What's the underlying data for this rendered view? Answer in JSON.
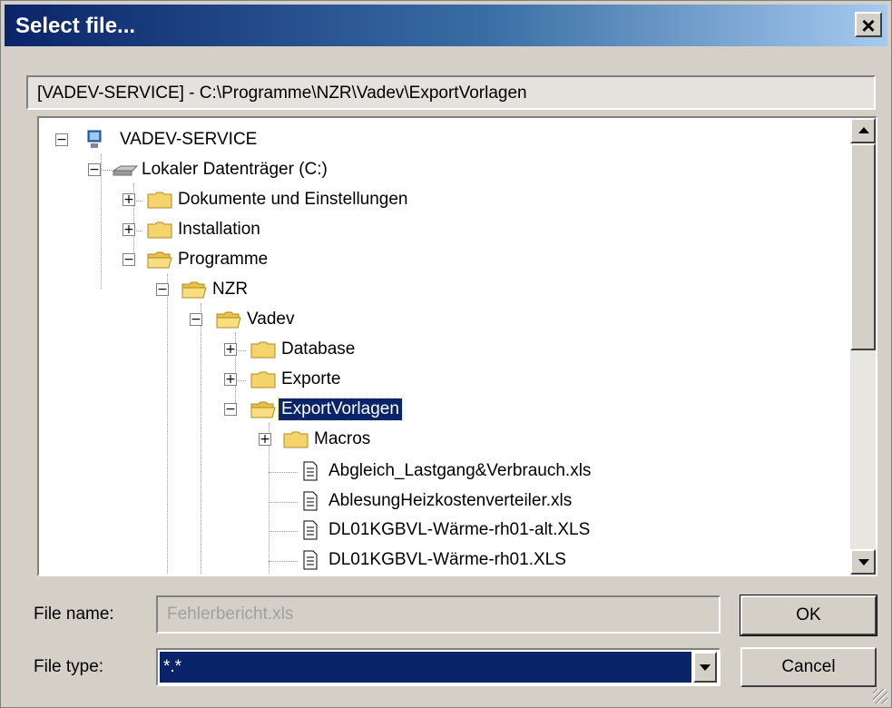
{
  "window": {
    "title": "Select file..."
  },
  "path": "[VADEV-SERVICE] - C:\\Programme\\NZR\\Vadev\\ExportVorlagen",
  "tree": [
    {
      "label": "VADEV-SERVICE",
      "icon": "computer-icon",
      "expander": "⊟"
    },
    {
      "label": "Lokaler Datenträger (C:)",
      "icon": "drive-icon",
      "expander": "⊟"
    },
    {
      "label": "Dokumente und Einstellungen",
      "icon": "folder-icon",
      "expander": "⊞"
    },
    {
      "label": "Installation",
      "icon": "folder-icon",
      "expander": "⊞"
    },
    {
      "label": "Programme",
      "icon": "open-folder-icon",
      "expander": "⊟"
    },
    {
      "label": "NZR",
      "icon": "open-folder-icon",
      "expander": "⊟"
    },
    {
      "label": "Vadev",
      "icon": "open-folder-icon",
      "expander": "⊟"
    },
    {
      "label": "Database",
      "icon": "folder-icon",
      "expander": "⊞"
    },
    {
      "label": "Exporte",
      "icon": "folder-icon",
      "expander": "⊞"
    },
    {
      "label": "ExportVorlagen",
      "icon": "open-folder-icon",
      "expander": "⊟",
      "selected": true
    },
    {
      "label": "Macros",
      "icon": "folder-icon",
      "expander": "⊞"
    },
    {
      "label": "Abgleich_Lastgang&Verbrauch.xls",
      "icon": "file-icon"
    },
    {
      "label": "AblesungHeizkostenverteiler.xls",
      "icon": "file-icon"
    },
    {
      "label": "DL01KGBVL-Wärme-rh01-alt.XLS",
      "icon": "file-icon"
    },
    {
      "label": "DL01KGBVL-Wärme-rh01.XLS",
      "icon": "file-icon"
    }
  ],
  "form": {
    "file_name_label": "File name:",
    "file_name_value": "Fehlerbericht.xls",
    "file_type_label": "File type:",
    "file_type_value": "*.*"
  },
  "buttons": {
    "ok": "OK",
    "cancel": "Cancel"
  },
  "colors": {
    "titlebar": "#0a246a",
    "selection": "#0a246a",
    "face": "#d4d0c8"
  }
}
